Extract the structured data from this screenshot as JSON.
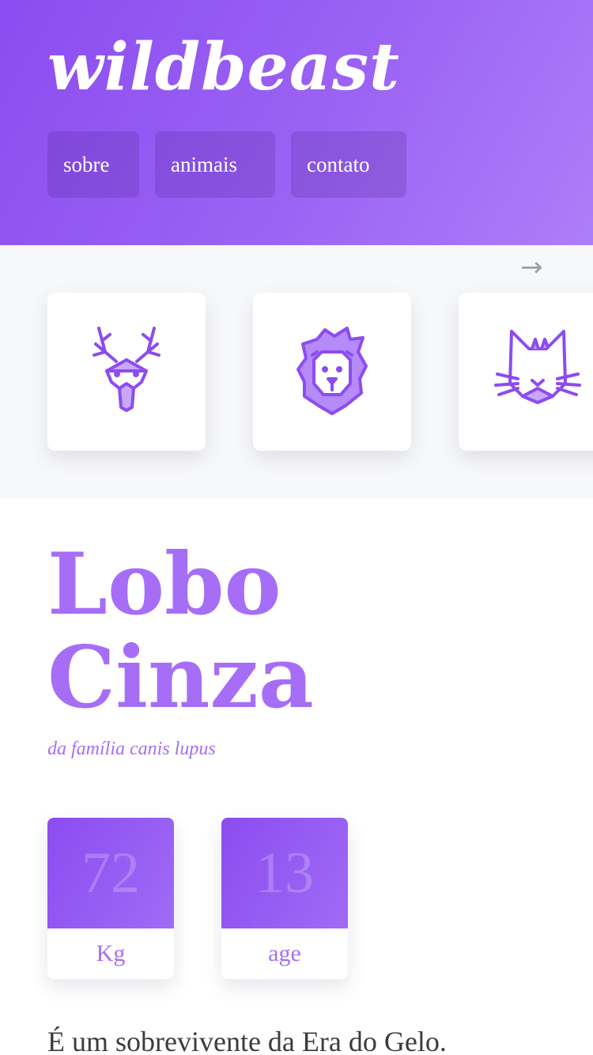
{
  "header": {
    "logo": "wildbeast",
    "nav": [
      {
        "label": "sobre"
      },
      {
        "label": "animais"
      },
      {
        "label": "contato"
      }
    ]
  },
  "carousel": {
    "arrow": "→",
    "cards": [
      {
        "icon": "deer-icon"
      },
      {
        "icon": "lion-icon"
      },
      {
        "icon": "cat-icon"
      }
    ]
  },
  "animal": {
    "title_line1": "Lobo",
    "title_line2": "Cinza",
    "subtitle": "da família canis lupus",
    "stats": [
      {
        "value": "72",
        "label": "Kg"
      },
      {
        "value": "13",
        "label": "age"
      }
    ],
    "description": "É um sobrevivente da Era do Gelo."
  },
  "colors": {
    "accent": "#a66ef7",
    "gradient_start": "#8c4cf0",
    "gradient_end": "#ad7ef9",
    "carousel_bg": "#f7f8fa"
  }
}
